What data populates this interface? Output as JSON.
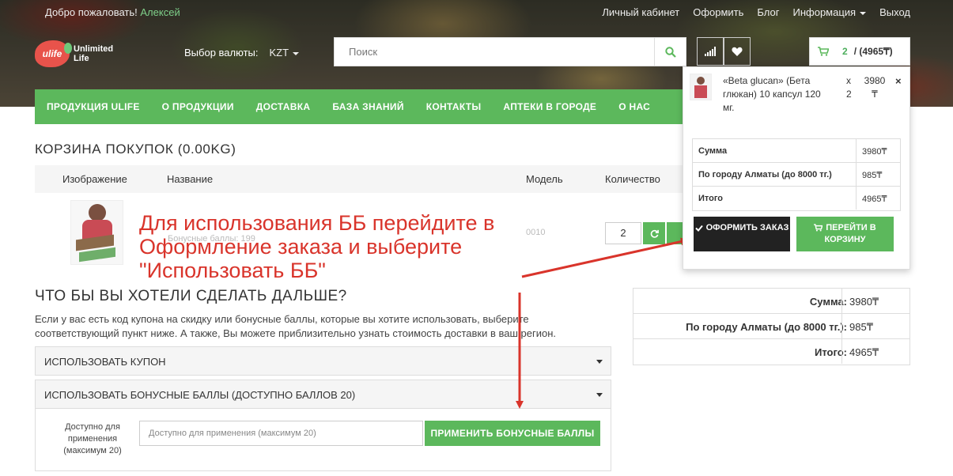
{
  "topbar": {
    "welcome_prefix": "Добро пожаловать!",
    "user_name": "Алексей",
    "links": [
      "Личный кабинет",
      "Оформить",
      "Блог",
      "Информация",
      "Выход"
    ]
  },
  "logo": {
    "badge": "ulife",
    "line1": "Unlimited",
    "line2": "Life"
  },
  "currency": {
    "label": "Выбор валюты:",
    "value": "KZT"
  },
  "search": {
    "placeholder": "Поиск"
  },
  "cart_button": {
    "count": "2",
    "total": "/ (4965₸)"
  },
  "nav": {
    "items": [
      "ПРОДУКЦИЯ ULIFE",
      "О ПРОДУКЦИИ",
      "ДОСТАВКА",
      "БАЗА ЗНАНИЙ",
      "КОНТАКТЫ",
      "АПТЕКИ В ГОРОДЕ",
      "О НАС"
    ]
  },
  "cart_page": {
    "title": "КОРЗИНА ПОКУПОК  (0.00KG)",
    "columns": [
      "Изображение",
      "Название",
      "Модель",
      "Количество"
    ],
    "faint_name": "Бонусные баллы: 199",
    "faint_model": "0010",
    "quantity": "2"
  },
  "whatnext": {
    "title": "ЧТО БЫ ВЫ ХОТЕЛИ СДЕЛАТЬ ДАЛЬШЕ?",
    "desc": "Если у вас есть код купона на скидку или бонусные баллы, которые вы хотите использовать, выберите соответствующий пункт ниже. А также, Вы можете приблизительно узнать стоимость доставки в ваш регион.",
    "coupon_label": "ИСПОЛЬЗОВАТЬ КУПОН",
    "bonus_label": "ИСПОЛЬЗОВАТЬ БОНУСНЫЕ БАЛЛЫ (ДОСТУПНО БАЛЛОВ 20)",
    "bonus_field_label": "Доступно для применения (максимум 20)",
    "bonus_placeholder": "Доступно для применения (максимум 20)",
    "bonus_apply": "ПРИМЕНИТЬ БОНУСНЫЕ БАЛЛЫ"
  },
  "totals": [
    {
      "label": "Сумма:",
      "value": "3980₸"
    },
    {
      "label": "По городу Алматы (до 8000 тг.):",
      "value": "985₸"
    },
    {
      "label": "Итого:",
      "value": "4965₸"
    }
  ],
  "dropdown": {
    "item_name": "«Beta glucan» (Бета глюкан) 10 капсул 120 мг.",
    "item_qty": "x 2",
    "item_price": "3980 ₸",
    "close": "×",
    "rows": [
      {
        "label": "Сумма",
        "value": "3980₸"
      },
      {
        "label": "По городу Алматы (до 8000 тг.)",
        "value": "985₸"
      },
      {
        "label": "Итого",
        "value": "4965₸"
      }
    ],
    "checkout": "ОФОРМИТЬ ЗАКАЗ",
    "view_cart": "ПЕРЕЙТИ В КОРЗИНУ"
  },
  "annotation": {
    "text": "Для использования ББ перейдите в Оформление заказа и выберите \"Использовать ББ\"",
    "color": "#d9342b"
  },
  "colors": {
    "accent": "#5cb85c",
    "dark_button": "#222222",
    "annotation": "#d9342b"
  },
  "icons": [
    "search-icon",
    "compare-icon",
    "heart-icon",
    "cart-icon",
    "refresh-icon",
    "check-icon",
    "caret-down-icon"
  ]
}
